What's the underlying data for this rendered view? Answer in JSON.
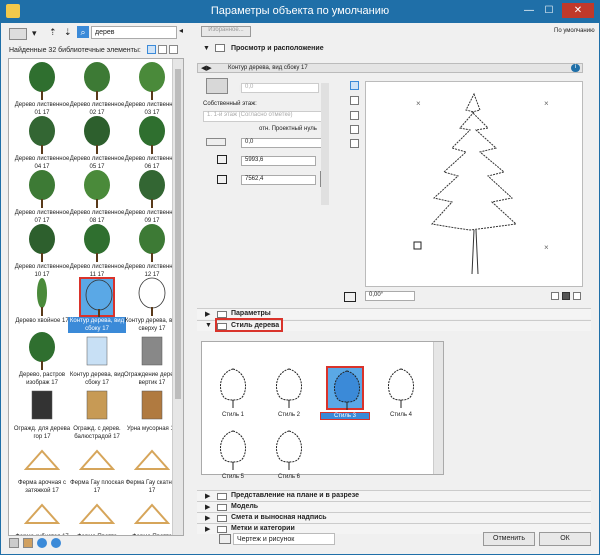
{
  "window": {
    "title": "Параметры объекта по умолчанию",
    "minimize": "—",
    "maximize": "☐",
    "close": "✕"
  },
  "search": {
    "value": "дерев"
  },
  "library": {
    "found_label": "Найденные 32 библиотечные элементы:",
    "items": [
      {
        "label": "Дерево лиственное 01 17"
      },
      {
        "label": "Дерево лиственное 02 17"
      },
      {
        "label": "Дерево лиственное 03 17"
      },
      {
        "label": "Дерево лиственное 04 17"
      },
      {
        "label": "Дерево лиственное 05 17"
      },
      {
        "label": "Дерево лиственное 06 17"
      },
      {
        "label": "Дерево лиственное 07 17"
      },
      {
        "label": "Дерево лиственное 08 17"
      },
      {
        "label": "Дерево лиственное 09 17"
      },
      {
        "label": "Дерево лиственное 10 17"
      },
      {
        "label": "Дерево лиственное 11 17"
      },
      {
        "label": "Дерево лиственное 12 17"
      },
      {
        "label": "Дерево хвойное 17"
      },
      {
        "label": "Контур дерева, вид сбоку 17"
      },
      {
        "label": "Контур дерева, вид сверху 17"
      },
      {
        "label": "Дерево, растров изобрaж 17"
      },
      {
        "label": "Контур дерева, вид сбоку 17"
      },
      {
        "label": "Ограждение дерева вертик 17"
      },
      {
        "label": "Огражд. для дерева гор 17"
      },
      {
        "label": "Огражд. с дерев. балюстрадой 17"
      },
      {
        "label": "Урна мусорная 17"
      },
      {
        "label": "Ферма арочная с затяжкой 17"
      },
      {
        "label": "Ферма Гау плоская 17"
      },
      {
        "label": "Ферма Гау скатная 17"
      },
      {
        "label": "Ферма кубистая 17"
      },
      {
        "label": "Ферма Пратта плоская 17"
      },
      {
        "label": "Ферма Пратта скатная 17"
      }
    ]
  },
  "top": {
    "favorites": "Избранное...",
    "default_label": "По умолчанию"
  },
  "preview_section": {
    "title": "Просмотр и расположение",
    "object_name": "Контур дерева, вид сбоку 17",
    "angle_top": "0,0",
    "story_label": "Собственный этаж:",
    "story_value": "1. 1-й этаж (Согласно отметке)",
    "ref_label": "отн. Проектный нуль",
    "elev_value": "0,0",
    "width_value": "5993,6",
    "height_value": "7562,4",
    "rotation_value": "0,00°"
  },
  "params_section": {
    "title": "Параметры"
  },
  "style_section": {
    "title": "Стиль дерева",
    "styles": [
      {
        "label": "Стиль 1"
      },
      {
        "label": "Стиль 2"
      },
      {
        "label": "Стиль 3"
      },
      {
        "label": "Стиль 4"
      },
      {
        "label": "Стиль 5"
      },
      {
        "label": "Стиль 6"
      }
    ]
  },
  "other_sections": [
    {
      "title": "Представление на плане и в разрезе"
    },
    {
      "title": "Модель"
    },
    {
      "title": "Смета и выносная надпись"
    },
    {
      "title": "Метки и категории"
    }
  ],
  "bottom": {
    "layer_value": "Чертеж и рисунок",
    "cancel": "Отменить",
    "ok": "ОК"
  },
  "colors": {
    "titlebar": "#1f6fa8",
    "selection": "#3b8ad8",
    "highlight": "#d9332b"
  }
}
